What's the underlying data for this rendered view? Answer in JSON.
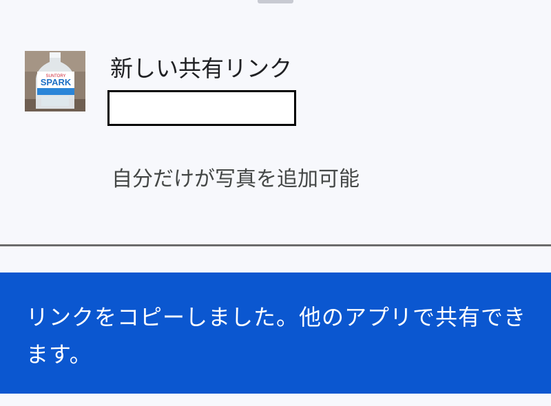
{
  "album": {
    "title": "新しい共有リンク",
    "thumbnail_label": "SPARK",
    "thumbnail_brand": "SUNTORY",
    "permission": "自分だけが写真を追加可能"
  },
  "snackbar": {
    "message": "リンクをコピーしました。他のアプリで共有できます。"
  },
  "colors": {
    "snackbar_bg": "#0b57d0",
    "sheet_bg": "#f7f8fc"
  }
}
